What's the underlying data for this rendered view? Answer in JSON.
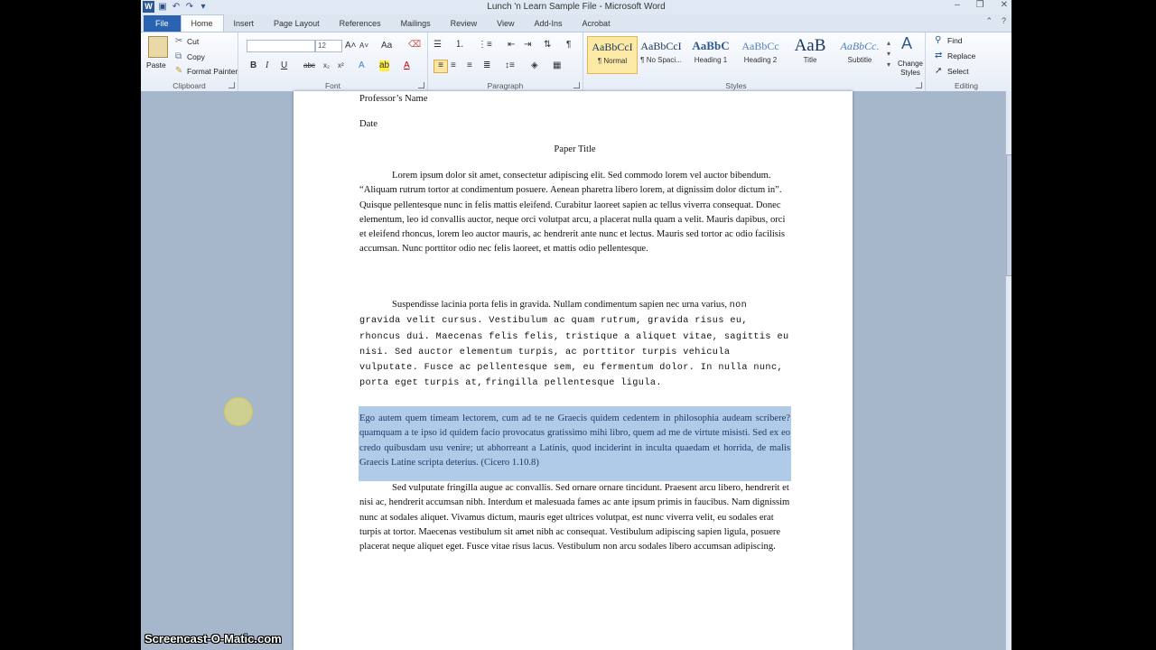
{
  "window": {
    "title": "Lunch 'n Learn Sample File  -  Microsoft Word",
    "controls": [
      "–",
      "❐",
      "✕"
    ]
  },
  "tabs": [
    {
      "label": "File"
    },
    {
      "label": "Home"
    },
    {
      "label": "Insert"
    },
    {
      "label": "Page Layout"
    },
    {
      "label": "References"
    },
    {
      "label": "Mailings"
    },
    {
      "label": "Review"
    },
    {
      "label": "View"
    },
    {
      "label": "Add-Ins"
    },
    {
      "label": "Acrobat"
    }
  ],
  "ribbon": {
    "clipboard": {
      "label": "Clipboard",
      "paste": "Paste",
      "cut": "Cut",
      "copy": "Copy",
      "format_painter": "Format Painter"
    },
    "font": {
      "label": "Font",
      "font_name": "",
      "font_size": "12"
    },
    "paragraph": {
      "label": "Paragraph"
    },
    "styles": {
      "label": "Styles",
      "items": [
        {
          "preview": "AaBbCcI",
          "name": "¶ Normal"
        },
        {
          "preview": "AaBbCcI",
          "name": "¶ No Spaci..."
        },
        {
          "preview": "AaBbC",
          "name": "Heading 1"
        },
        {
          "preview": "AaBbCc",
          "name": "Heading 2"
        },
        {
          "preview": "AaB",
          "name": "Title"
        },
        {
          "preview": "AaBbCc.",
          "name": "Subtitle"
        }
      ],
      "change_styles": "Change Styles"
    },
    "editing": {
      "label": "Editing",
      "find": "Find",
      "replace": "Replace",
      "select": "Select"
    }
  },
  "document": {
    "professor": "Professor’s Name",
    "date": "Date",
    "paper_title": "Paper Title",
    "para1": "Lorem ipsum dolor sit amet, consectetur adipiscing elit. Sed commodo lorem vel auctor bibendum. “Aliquam rutrum tortor at condimentum posuere. Aenean pharetra libero lorem, at dignissim dolor dictum in”. Quisque pellentesque nunc in felis mattis eleifend. Curabitur laoreet sapien ac tellus viverra consequat. Donec elementum, leo id convallis auctor, neque orci volutpat arcu, a placerat nulla quam a velit. Mauris dapibus, orci et eleifend rhoncus, lorem leo auctor mauris, ac hendrerit ante nunc et lectus. Mauris sed tortor ac odio facilisis accumsan. Nunc porttitor odio nec felis laoreet, et mattis odio pellentesque.",
    "para2_start": "Suspendisse lacinia porta felis in gravida. Nullam condimentum sapien nec urna varius,",
    "para2_mono": "non gravida velit cursus. Vestibulum ac quam rutrum, gravida risus eu, rhoncus dui. Maecenas felis felis, tristique a aliquet vitae, sagittis eu nisi. Sed auctor elementum turpis, ac porttitor turpis vehicula vulputate. Fusce ac pellentesque sem, eu fermentum dolor. In nulla nunc, porta eget turpis at,",
    "para2_end": "fringilla pellentesque ligula.",
    "quote": "Ego autem quem timeam lectorem, cum ad te ne Graecis quidem cedentem in philosophia audeam scribere? quamquam a te ipso id quidem facio provocatus gratissimo mihi libro, quem ad me de virtute misisti.  Sed ex eo credo quibusdam usu venire; ut abhorreant a Latinis, quod inciderint in inculta quaedam et horrida, de malis  Graecis Latine scripta deterius. (Cicero 1.10.8)",
    "para4": "Sed vulputate fringilla augue ac convallis. Sed ornare ornare tincidunt. Praesent arcu libero, hendrerit et nisi ac, hendrerit accumsan nibh. Interdum et malesuada fames ac ante ipsum primis in faucibus. Nam dignissim nunc at sodales aliquet. Vivamus dictum, mauris eget ultrices volutpat, est nunc viverra velit, eu sodales erat turpis at tortor. Maecenas vestibulum sit amet nibh ac consequat. Vestibulum adipiscing sapien ligula, posuere placerat neque aliquet eget. Fusce vitae risus lacus. Vestibulum non arcu sodales libero accumsan adipiscing."
  },
  "watermark": "Screencast-O-Matic.com",
  "colors": {
    "file_tab": "#2a63b3",
    "selection": "#b0cbe8",
    "ribbon_bg": "#fbfcfe"
  }
}
